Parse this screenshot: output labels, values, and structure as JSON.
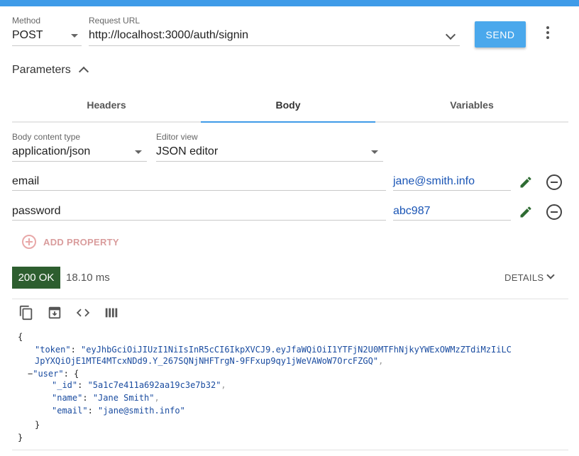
{
  "request": {
    "method_label": "Method",
    "method": "POST",
    "url_label": "Request URL",
    "url": "http://localhost:3000/auth/signin",
    "send_label": "SEND"
  },
  "parameters": {
    "title": "Parameters",
    "tabs": [
      {
        "label": "Headers"
      },
      {
        "label": "Body",
        "active": true
      },
      {
        "label": "Variables"
      }
    ]
  },
  "body": {
    "content_type_label": "Body content type",
    "content_type": "application/json",
    "editor_view_label": "Editor view",
    "editor_view": "JSON editor",
    "properties": [
      {
        "name": "email",
        "value": "jane@smith.info"
      },
      {
        "name": "password",
        "value": "abc987"
      }
    ],
    "add_property_label": "ADD PROPERTY"
  },
  "response": {
    "status": "200 OK",
    "timing": "18.10 ms",
    "details_label": "DETAILS",
    "status_color": "#2d5e2f",
    "accent_color": "#3f9be8",
    "toolbar_icons": [
      "copy-icon",
      "download-icon",
      "code-view-icon",
      "columns-icon"
    ],
    "json": {
      "open_brace": "{",
      "token_key": "\"token\"",
      "token_value_1": "\"eyJhbGciOiJIUzI1NiIsInR5cCI6IkpXVCJ9.eyJfaWQiOiI1YTFjN2U0MTFhNjkyYWExOWMzZTdiMzIiLC",
      "token_value_2": "JpYXQiOjE1MTE4MTcxNDd9.Y_267SQNjNHFTrgN-9FFxup9qy1jWeVAWoW7OrcFZGQ\"",
      "user_key": "\"user\"",
      "user_open": "{",
      "id_key": "\"_id\"",
      "id_value": "\"5a1c7e411a692aa19c3e7b32\"",
      "name_key": "\"name\"",
      "name_value": "\"Jane Smith\"",
      "email_key": "\"email\"",
      "email_value": "\"jane@smith.info\"",
      "user_close": "}",
      "close_brace": "}",
      "collapse_toggle": "−"
    }
  }
}
